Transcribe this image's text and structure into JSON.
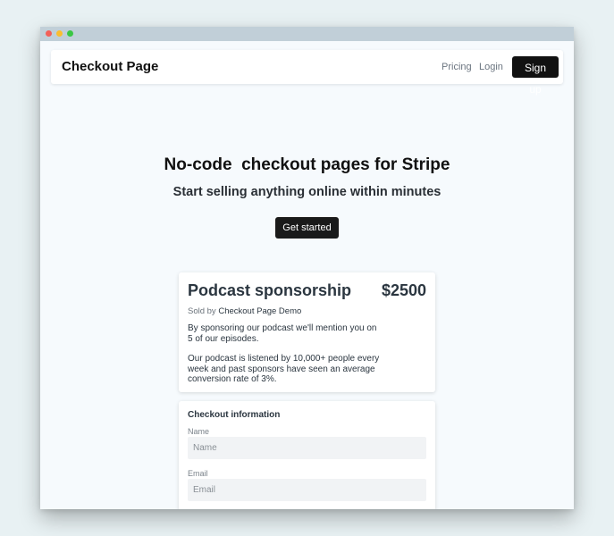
{
  "navbar": {
    "brand": "Checkout Page",
    "links": [
      "Pricing",
      "Login"
    ],
    "signup_label": "Sign up"
  },
  "hero": {
    "title": "No-code  checkout pages for Stripe",
    "subtitle": "Start selling anything online within minutes",
    "cta_label": "Get started"
  },
  "product": {
    "title": "Podcast sponsorship",
    "price": "$2500",
    "sold_by_prefix": "Sold by",
    "seller": "Checkout Page Demo",
    "description_1": "By sponsoring our podcast we'll mention you on 5 of our episodes.",
    "description_2": "Our podcast is listened by 10,000+ people every week and past sponsors have seen an average conversion rate of 3%."
  },
  "checkout": {
    "heading": "Checkout information",
    "name_label": "Name",
    "name_placeholder": "Name",
    "email_label": "Email",
    "email_placeholder": "Email"
  },
  "colors": {
    "background": "#e8f1f3",
    "page": "#f6fafd",
    "button": "#111111"
  }
}
